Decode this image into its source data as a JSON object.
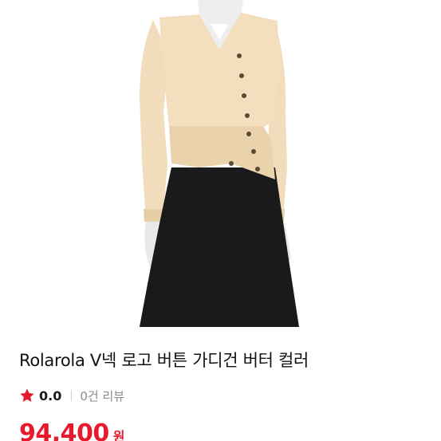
{
  "product": {
    "image_icon": "product-photo",
    "title": "Rolarola V넥 로고 버튼 가디건 버터 컬러",
    "rating": "0.0",
    "rating_icon": "star-icon",
    "review_text": "0건 리뷰",
    "price": "94,400",
    "currency": "원"
  },
  "colors": {
    "accent": "#e8192c",
    "star": "#e8192c",
    "title": "#111111",
    "muted": "#8a8a8a",
    "cardigan": "#f3dfbd",
    "skirt": "#1a1a1d"
  }
}
